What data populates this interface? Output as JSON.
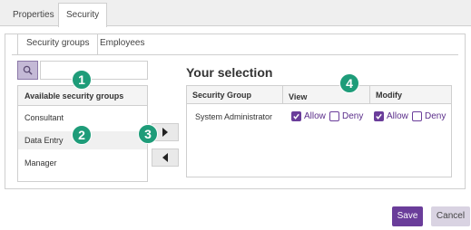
{
  "top_tabs": [
    {
      "label": "Properties",
      "active": false
    },
    {
      "label": "Security",
      "active": true
    }
  ],
  "sub_tabs": [
    {
      "label": "Security groups",
      "active": true
    },
    {
      "label": "Employees",
      "active": false
    }
  ],
  "search": {
    "value": "",
    "icon": "search-icon"
  },
  "available_list": {
    "header": "Available security groups",
    "items": [
      "Consultant",
      "Data Entry",
      "Manager"
    ],
    "highlighted": "Data Entry"
  },
  "transfer": {
    "add_icon": "arrow-right-icon",
    "remove_icon": "arrow-left-icon"
  },
  "selection": {
    "title": "Your selection",
    "columns": [
      "Security Group",
      "View",
      "Modify"
    ],
    "rows": [
      {
        "group": "System Administrator",
        "view": {
          "allow_label": "Allow",
          "allow_checked": true,
          "deny_label": "Deny",
          "deny_checked": false
        },
        "modify": {
          "allow_label": "Allow",
          "allow_checked": true,
          "deny_label": "Deny",
          "deny_checked": false
        }
      }
    ]
  },
  "callouts": [
    "1",
    "2",
    "3",
    "4"
  ],
  "footer": {
    "save_label": "Save",
    "cancel_label": "Cancel"
  },
  "colors": {
    "accent": "#6a3d9a",
    "callout": "#1e9c79",
    "cancel_bg": "#d9d3e2"
  }
}
